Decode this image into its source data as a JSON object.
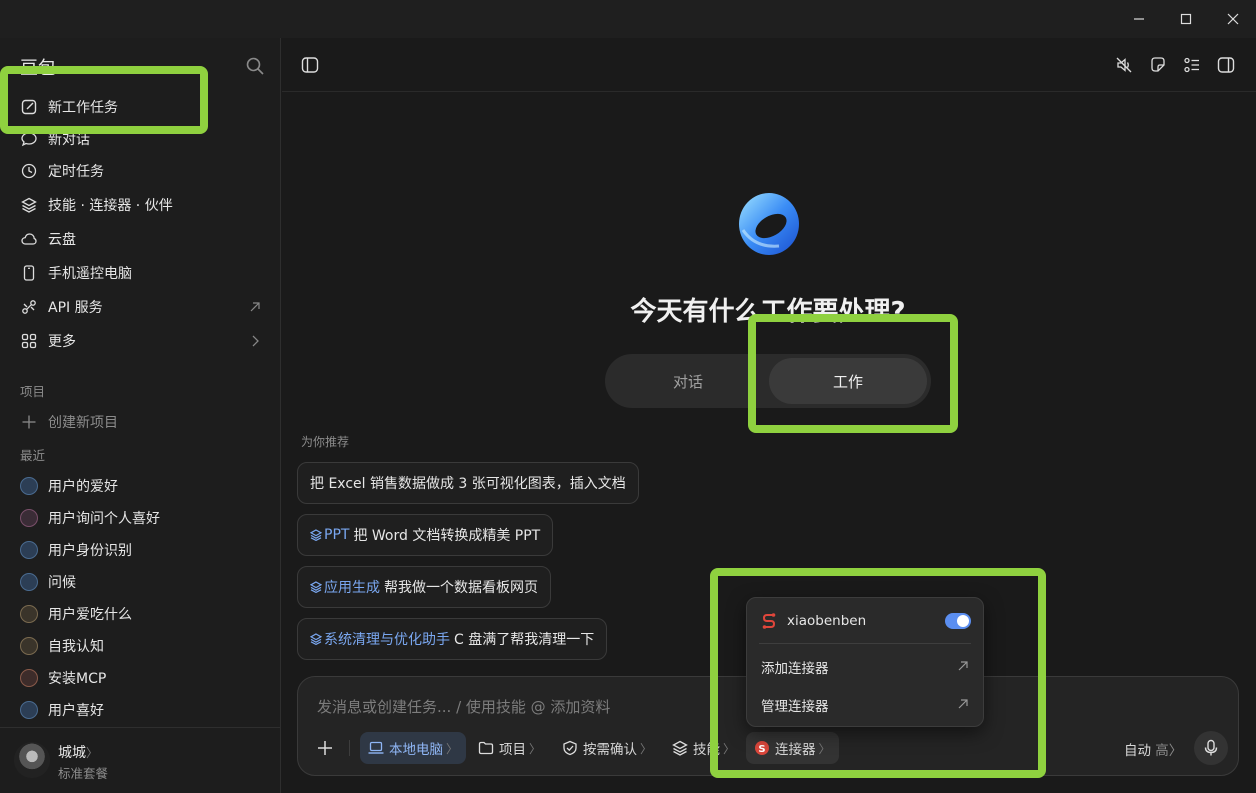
{
  "window": {
    "controls": [
      "minimize",
      "maximize",
      "close"
    ]
  },
  "sidebar": {
    "brand": "豆包",
    "items": [
      {
        "label": "新工作任务",
        "icon": "edit-icon"
      },
      {
        "label": "新对话",
        "icon": "chat-bubble-icon"
      },
      {
        "label": "定时任务",
        "icon": "clock-icon"
      },
      {
        "label": "技能 · 连接器 · 伙伴",
        "icon": "layers-icon"
      },
      {
        "label": "云盘",
        "icon": "cloud-icon"
      },
      {
        "label": "手机遥控电脑",
        "icon": "phone-icon"
      },
      {
        "label": "API 服务",
        "icon": "api-icon"
      },
      {
        "label": "更多",
        "icon": "grid-icon"
      }
    ],
    "projects_title": "项目",
    "create_project": "创建新项目",
    "recent_title": "最近",
    "recent": [
      {
        "label": "用户的爱好",
        "kind": "work"
      },
      {
        "label": "用户询问个人喜好",
        "kind": "chat"
      },
      {
        "label": "用户身份识别",
        "kind": "work"
      },
      {
        "label": "问候",
        "kind": "work"
      },
      {
        "label": "用户爱吃什么",
        "kind": "chat2"
      },
      {
        "label": "自我认知",
        "kind": "chat2"
      },
      {
        "label": "安装MCP",
        "kind": "chat3"
      },
      {
        "label": "用户喜好",
        "kind": "work"
      }
    ],
    "user": {
      "name": "城城",
      "plan": "标准套餐"
    }
  },
  "main": {
    "headline": "今天有什么工作要处理?",
    "modes": {
      "chat": "对话",
      "work": "工作"
    },
    "recommend_title": "为你推荐",
    "chips": [
      {
        "tag": "",
        "text": "把 Excel 销售数据做成 3 张可视化图表，插入文档"
      },
      {
        "tag": "PPT",
        "text": "把 Word 文档转换成精美 PPT"
      },
      {
        "tag": "应用生成",
        "text": "帮我做一个数据看板网页"
      },
      {
        "tag": "系统清理与优化助手",
        "text": "C 盘满了帮我清理一下"
      }
    ]
  },
  "composer": {
    "placeholder": "发消息或创建任务... / 使用技能 @ 添加资料",
    "tools": {
      "local": "本地电脑",
      "project": "项目",
      "confirm": "按需确认",
      "skill": "技能",
      "connector": "连接器"
    },
    "auto_label": "自动",
    "auto_level": "高",
    "chevron": "〉"
  },
  "popover": {
    "account": "xiaobenben",
    "add": "添加连接器",
    "manage": "管理连接器",
    "toggle_on": true
  },
  "colors": {
    "accent": "#5b8ef0",
    "highlight": "#8fd13f"
  }
}
